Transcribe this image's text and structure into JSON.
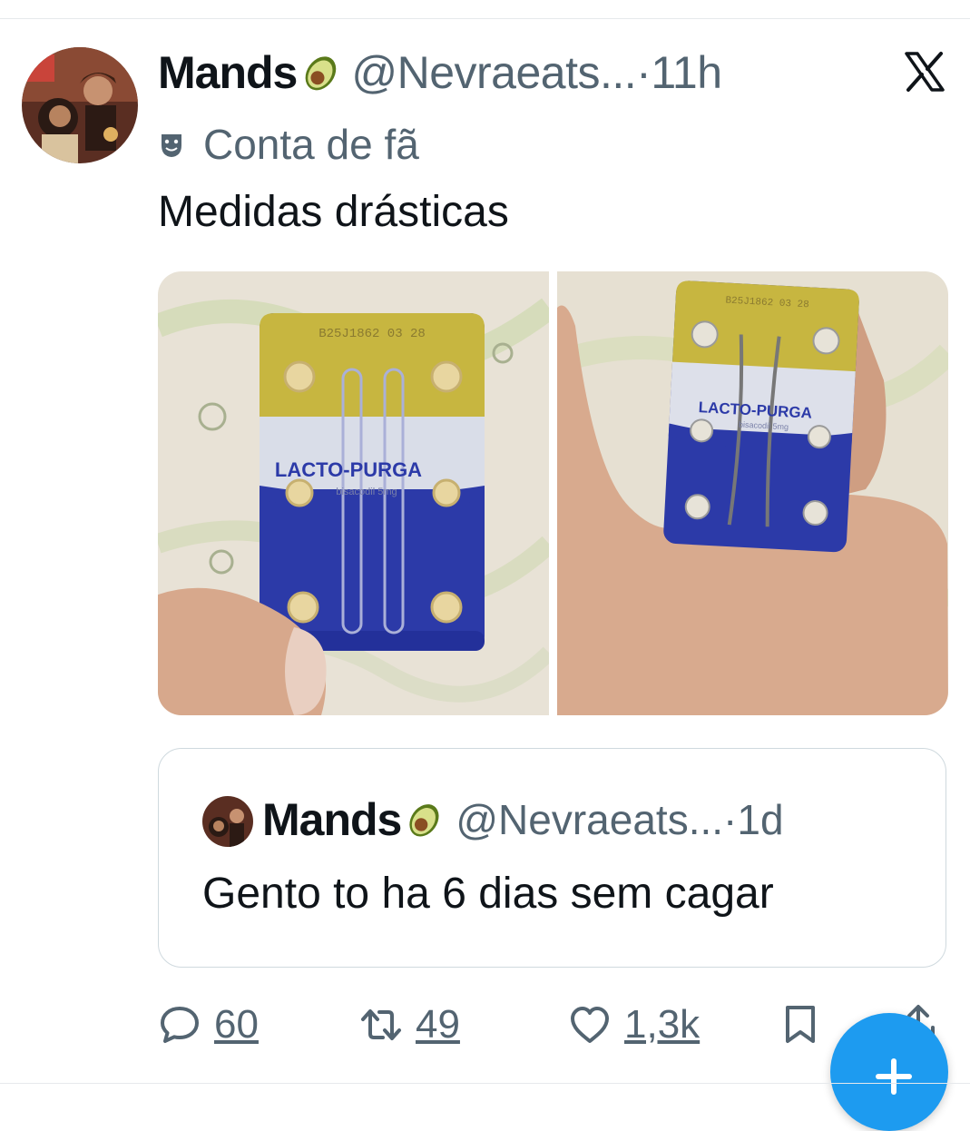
{
  "tweet": {
    "author_name": "Mands",
    "author_handle": "@Nevraeats...",
    "separator": "·",
    "time": "11h",
    "label": "Conta de fã",
    "text": "Medidas drásticas",
    "icons": {
      "name_emoji": "avocado-icon",
      "label_icon": "theater-masks-icon",
      "platform": "x-logo-icon"
    }
  },
  "media": {
    "images": [
      {
        "blister_lot": "B25J1862 03 28",
        "brand": "LACTO-PURGA",
        "subtitle": "bisacodil 5mg"
      },
      {
        "blister_lot": "B25J1862 03 28",
        "brand": "LACTO-PURGA",
        "subtitle": "bisacodil 5mg"
      }
    ]
  },
  "quote": {
    "author_name": "Mands",
    "author_handle": "@Nevraeats...",
    "separator": "·",
    "time": "1d",
    "text": "Gento to ha 6 dias sem cagar"
  },
  "actions": {
    "replies": "60",
    "retweets": "49",
    "likes": "1,3k"
  },
  "colors": {
    "text": "#0f1419",
    "secondary": "#536471",
    "border": "#cfd9de",
    "accent": "#1d9bf0"
  }
}
